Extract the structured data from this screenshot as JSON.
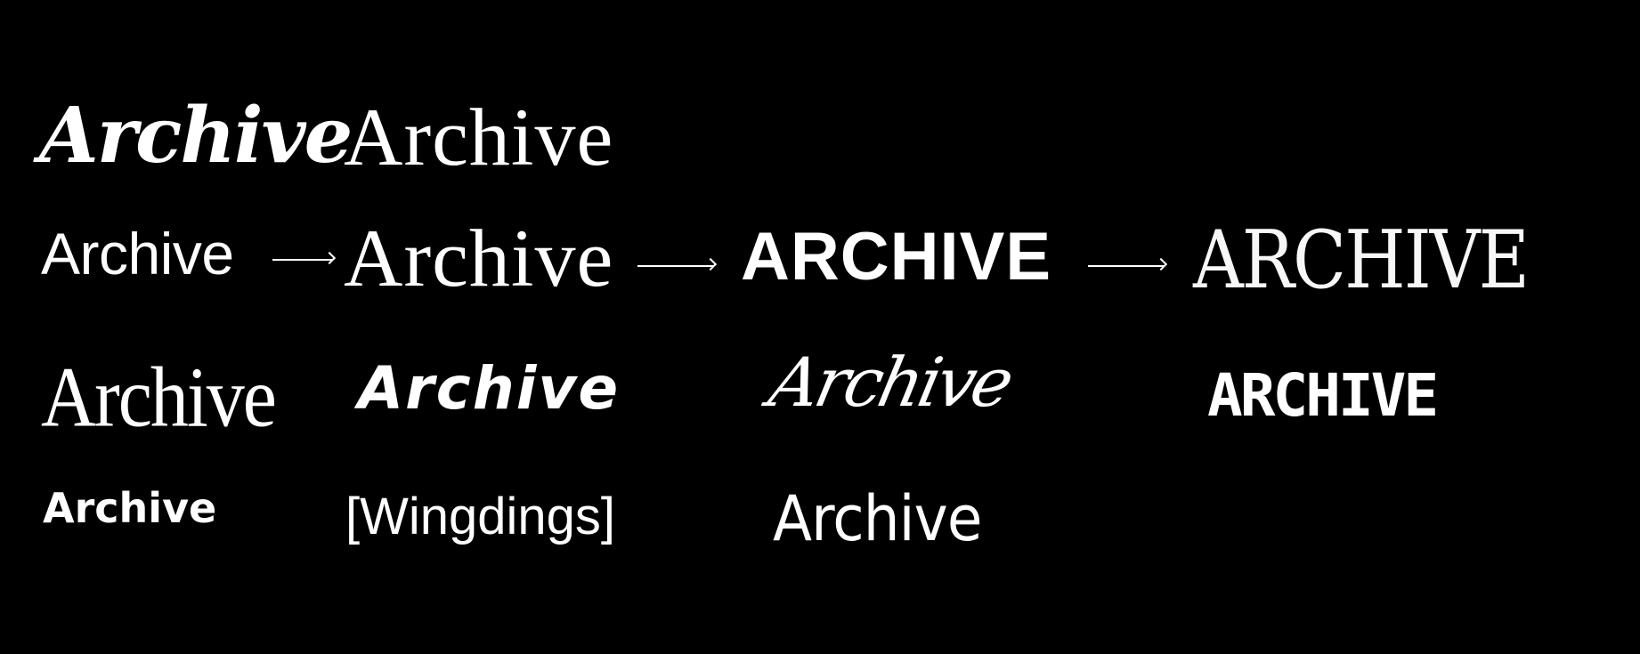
{
  "background_color": "#000000",
  "text_color": "#ffffff",
  "rows": [
    {
      "samples": [
        "Archive",
        "Archive"
      ]
    },
    {
      "samples": [
        "Archive",
        "Archive",
        "ARCHIVE",
        "ARCHIVE"
      ],
      "arrows": [
        "arrow-right-icon",
        "arrow-right-icon",
        "arrow-right-icon"
      ]
    },
    {
      "samples": [
        "Archive",
        "Archive",
        "Archive",
        "ARCHIVE"
      ]
    },
    {
      "samples": [
        "Archive",
        "[Wingdings]",
        "Archive"
      ]
    }
  ]
}
